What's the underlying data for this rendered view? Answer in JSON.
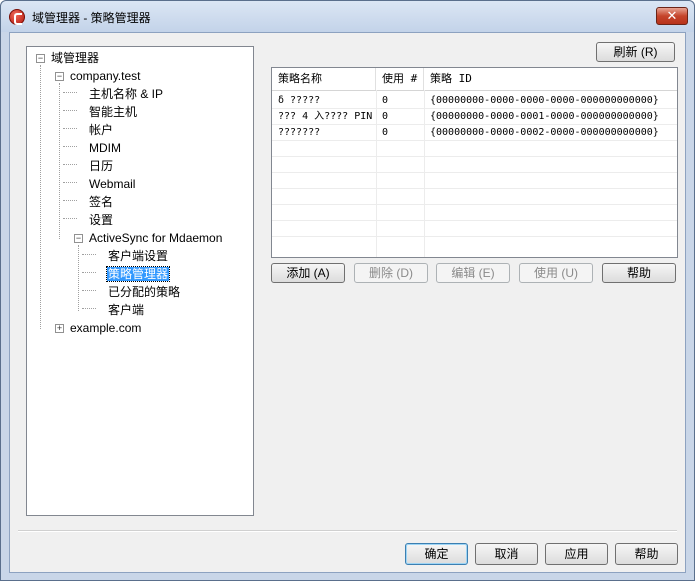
{
  "window": {
    "title": "域管理器 - 策略管理器",
    "close_glyph": "✕"
  },
  "tree": {
    "root": "域管理器",
    "domain1": "company.test",
    "items": [
      "主机名称 & IP",
      "智能主机",
      "帐户",
      "MDIM",
      "日历",
      "Webmail",
      "签名",
      "设置"
    ],
    "activesync": "ActiveSync for Mdaemon",
    "activesync_items": [
      "客户端设置",
      "策略管理器",
      "已分配的策略",
      "客户端"
    ],
    "domain2": "example.com",
    "selected": "策略管理器"
  },
  "refresh_button": "刷新 (R)",
  "policy_table": {
    "columns": [
      "策略名称",
      "使用 #",
      "策略 ID"
    ],
    "rows": [
      {
        "name": "δ ?????",
        "use": "0",
        "id": "{00000000-0000-0000-0000-000000000000}"
      },
      {
        "name": "??? 4 入???? PIN",
        "use": "0",
        "id": "{00000000-0000-0001-0000-000000000000}"
      },
      {
        "name": "???????",
        "use": "0",
        "id": "{00000000-0000-0002-0000-000000000000}"
      }
    ]
  },
  "action_buttons": {
    "add": "添加 (A)",
    "delete": "删除 (D)",
    "edit": "编辑 (E)",
    "use": "使用 (U)",
    "help": "帮助"
  },
  "dialog_buttons": {
    "ok": "确定",
    "cancel": "取消",
    "apply": "应用",
    "help": "帮助"
  }
}
